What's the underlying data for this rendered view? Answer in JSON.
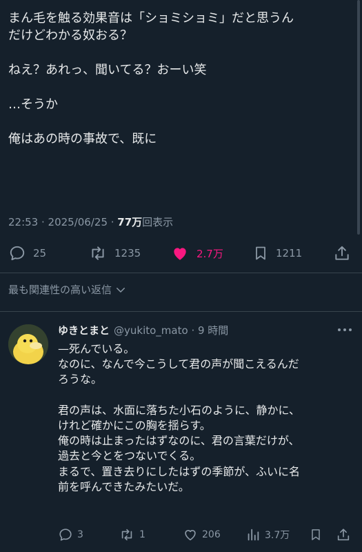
{
  "tweet": {
    "lines": [
      "まん毛を触る効果音は「ショミショミ」だと思うん",
      "だけどわかる奴おる？",
      "",
      "ねえ？あれっ、聞いてる？おーい笑",
      "",
      "…そうか",
      "",
      "俺はあの時の事故で、既に"
    ],
    "timestamp": "22:53 · 2025/06/25 · ",
    "views_number": "77万",
    "views_label": "回表示"
  },
  "actions": {
    "replies": "25",
    "reposts": "1235",
    "likes": "2.7万",
    "bookmarks": "1211"
  },
  "sort_label": "最も関連性の高い返信",
  "reply": {
    "name": "ゆきとまと",
    "handle": "@yukito_mato · 9 時間",
    "lines": [
      "—死んでいる。",
      "なのに、なんで今こうして君の声が聞こえるんだ",
      "ろうな。",
      "",
      "君の声は、水面に落ちた小石のように、静かに、",
      "けれど確かにこの胸を揺らす。",
      "俺の時は止まったはずなのに、君の言葉だけが、",
      "過去と今とをつないでくる。",
      "まるで、置き去りにしたはずの季節が、ふいに名",
      "前を呼んできたみたいだ。"
    ],
    "replies": "3",
    "reposts": "1",
    "likes": "206",
    "views": "3.7万"
  },
  "colors": {
    "background": "#15202b",
    "text": "#e7e9ea",
    "muted": "#8b98a5",
    "like": "#f91880",
    "divider": "#38444d"
  },
  "icons": [
    "reply-icon",
    "repost-icon",
    "heart-filled-icon",
    "bookmark-icon",
    "share-icon",
    "chevron-down-icon",
    "more-icon",
    "heart-outline-icon",
    "analytics-icon"
  ]
}
